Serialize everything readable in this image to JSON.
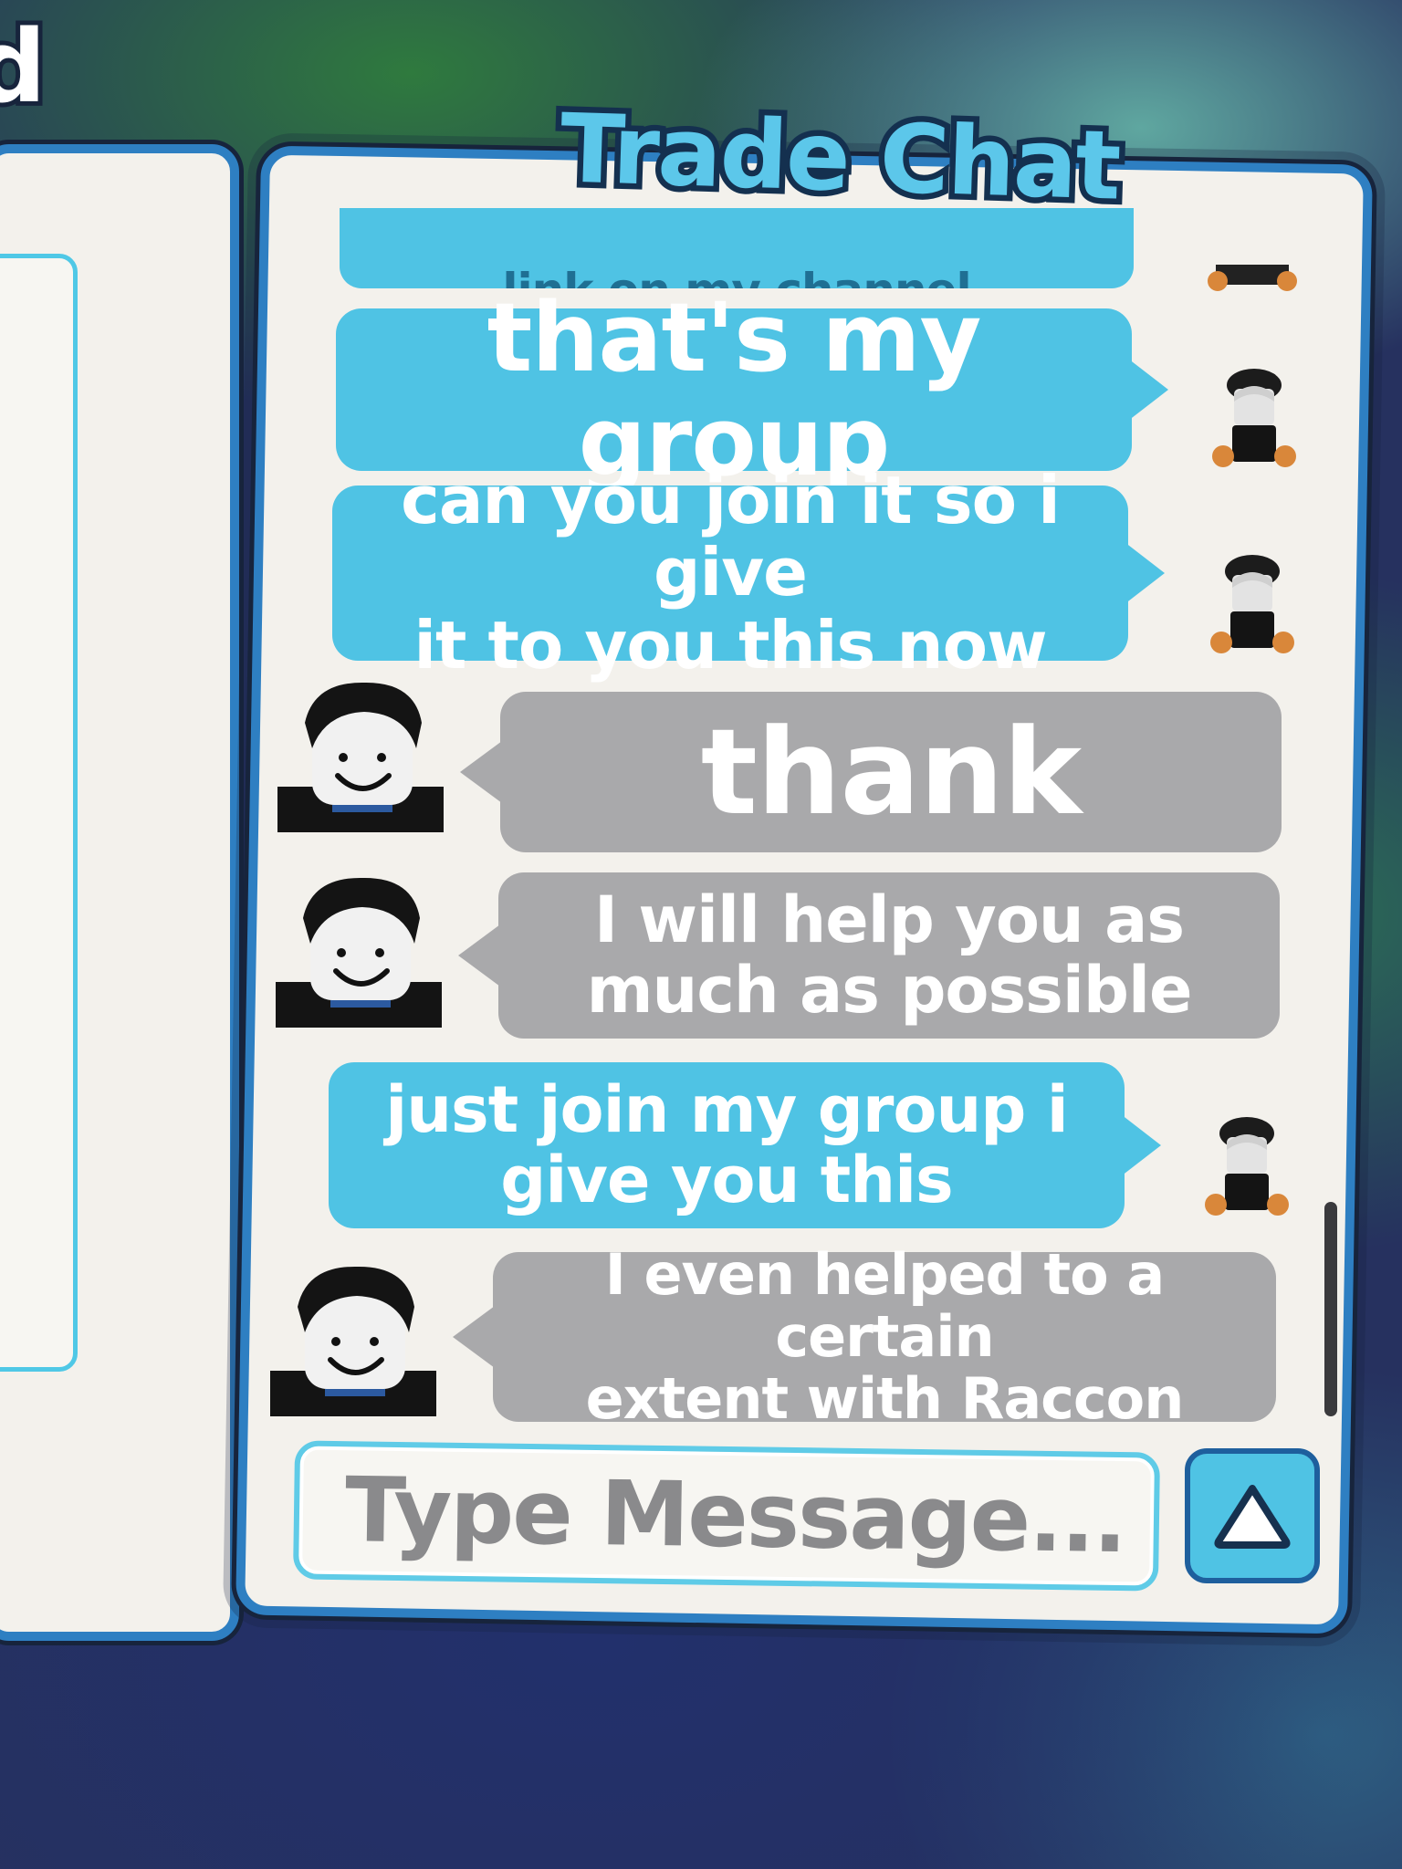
{
  "left_panel": {
    "heading_fragment": "d"
  },
  "chat": {
    "title": "Trade Chat",
    "messages": [
      {
        "side": "mine",
        "text": "link on my channel",
        "cut_off": true
      },
      {
        "side": "mine",
        "text": "that's my group"
      },
      {
        "side": "mine",
        "line1": "can you join it so i give",
        "line2": "it to you this now"
      },
      {
        "side": "theirs",
        "text": "thank"
      },
      {
        "side": "theirs",
        "line1": "I will help you as",
        "line2": "much as possible"
      },
      {
        "side": "mine",
        "line1": "just join my group i",
        "line2": "give you this"
      },
      {
        "side": "theirs",
        "line1": "I even helped to a certain",
        "line2": "extent with Raccon"
      }
    ],
    "input": {
      "placeholder": "Type Message..."
    },
    "send_icon": "triangle-up-icon",
    "colors": {
      "mine_bubble": "#4fc3e4",
      "theirs_bubble": "#a9a9ab",
      "panel_border": "#2e7fc2",
      "panel_background": "#f3f1ec"
    }
  }
}
